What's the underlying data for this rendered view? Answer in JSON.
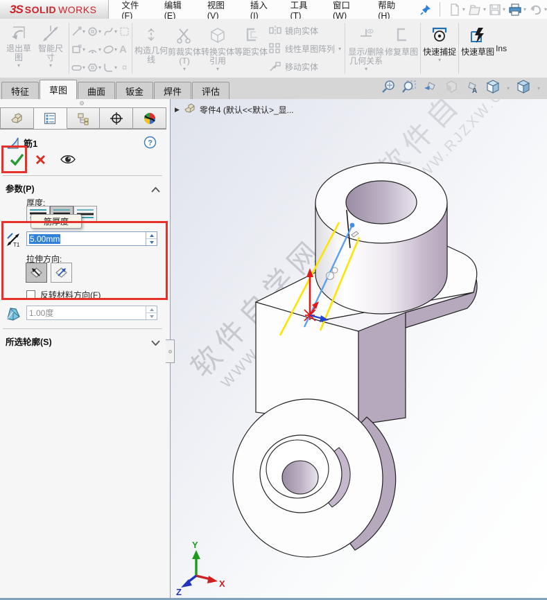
{
  "title_bar": {
    "logo_prefix": "3S",
    "logo_bold": "SOLID",
    "logo_light": "WORKS",
    "menus": [
      "文件(F)",
      "编辑(E)",
      "视图(V)",
      "插入(I)",
      "工具(T)",
      "窗口(W)",
      "帮助(H)"
    ]
  },
  "toolbar": {
    "exit_sketch": "退出草图",
    "smart_dimension": "智能尺寸",
    "text_tool": "A",
    "construction_geometry": "构造几何线",
    "trim_entities": "剪裁实体(T)",
    "convert_entities": "转换实体引用",
    "offset_entities": "等距实体",
    "mirror_entities": "镜向实体",
    "linear_sketch_pattern": "线性草图阵列",
    "move_entities": "移动实体",
    "display_delete_relations": "显示/删除几何关系",
    "repair_sketch": "修复草图",
    "quick_snaps": "快速捕捉",
    "rapid_sketch": "快速草图",
    "ins_partial": "Ins"
  },
  "ribbon_tabs": [
    "特征",
    "草图",
    "曲面",
    "钣金",
    "焊件",
    "评估"
  ],
  "property_manager": {
    "feature_name": "筋1",
    "parameters_header": "参数(P)",
    "thickness_label": "厚度:",
    "thickness_tooltip": "筋厚度",
    "thickness_value": "5.00mm",
    "direction_label": "拉伸方向:",
    "flip_material_label": "反转材料方向(F)",
    "draft_value": "1.00度",
    "selected_contours_header": "所选轮廓(S)"
  },
  "viewport": {
    "document_title": "零件4 (默认<<默认>_显...",
    "watermark_cn": "软件自学网",
    "watermark_url": "WWW.RJZXW.COM",
    "triad_x": "X",
    "triad_y": "Y",
    "triad_z": "Z"
  },
  "colors": {
    "annotation_red": "#e8302a",
    "selection_blue": "#2f80d6",
    "model_lavender": "#b7a9bd",
    "sketch_yellow": "#ffe400",
    "sketch_blue": "#59a0ee",
    "logo_red": "#cc2229"
  }
}
